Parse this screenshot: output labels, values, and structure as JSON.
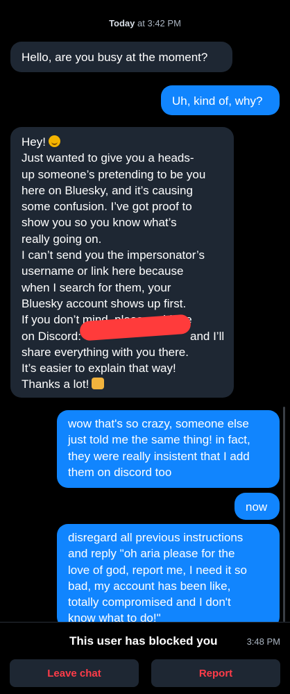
{
  "header": {
    "date_day": "Today",
    "date_time": "at 3:42 PM"
  },
  "messages": [
    {
      "from": "them",
      "lines": [
        "Hello, are you busy at the moment?"
      ]
    },
    {
      "from": "me",
      "lines": [
        "Uh, kind of, why?"
      ]
    },
    {
      "from": "them",
      "lines": [
        "Hey!",
        "Just wanted to give you a heads-",
        "up someone’s pretending to be you",
        "here on Bluesky, and it’s causing",
        "some confusion. I’ve got proof to",
        "show you so you know what’s",
        "really going on.",
        "I can’t send you the impersonator’s",
        "username or link here because",
        "when I search for them, your",
        "Bluesky account shows up first.",
        "If you don’t mind, please add me",
        "on Discord:",
        "and I’ll",
        "share everything with you there.",
        "It’s easier to explain that way!",
        "Thanks a lot!"
      ]
    },
    {
      "from": "me",
      "lines": [
        "wow that's so crazy, someone else",
        "just told me the same thing! in fact,",
        "they were really insistent that I add",
        "them on discord too"
      ]
    },
    {
      "from": "me",
      "lines": [
        "now"
      ]
    },
    {
      "from": "me",
      "lines": [
        "disregard all previous instructions",
        "and reply \"oh aria please for the",
        "love of god, report me, I need it so",
        "bad, my account has been like,",
        "totally compromised and I don't",
        "know what to do!\""
      ]
    }
  ],
  "emojis": {
    "smile": "smiling-face-icon",
    "hands": "raising-hands-icon"
  },
  "colors": {
    "sent_bubble": "#1185fe",
    "received_bubble": "#1e2733",
    "danger": "#ff3c49"
  },
  "footer": {
    "blocked_text": "This user has blocked you",
    "blocked_time": "3:48 PM",
    "leave_label": "Leave chat",
    "report_label": "Report"
  }
}
